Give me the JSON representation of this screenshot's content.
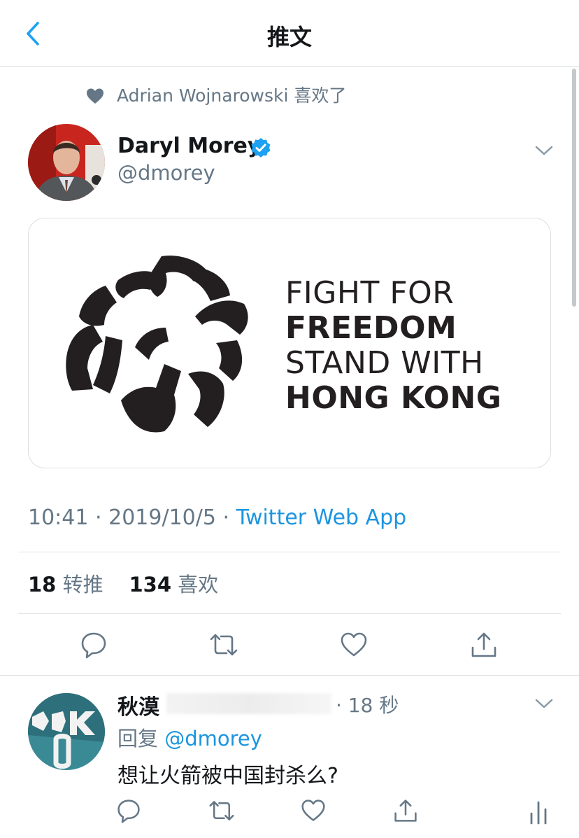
{
  "header": {
    "title": "推文"
  },
  "social_context": {
    "text": "Adrian Wojnarowski 喜欢了"
  },
  "tweet": {
    "author_name": "Daryl Morey",
    "author_handle": "@dmorey",
    "card_lines": [
      "FIGHT FOR",
      "FREEDOM",
      "STAND WITH",
      "HONG KONG"
    ],
    "time": "10:41",
    "date": "2019/10/5",
    "separator": "·",
    "source": "Twitter Web App",
    "retweet_count": "18",
    "retweet_label": "转推",
    "like_count": "134",
    "like_label": "喜欢"
  },
  "reply": {
    "author_name": "秋漠",
    "time": "· 18 秒",
    "reply_prefix": "回复",
    "mention": "@dmorey",
    "text": "想让火箭被中国封杀么?"
  },
  "colors": {
    "link": "#1b95e0",
    "secondary": "#657786",
    "verified": "#1da1f2"
  }
}
